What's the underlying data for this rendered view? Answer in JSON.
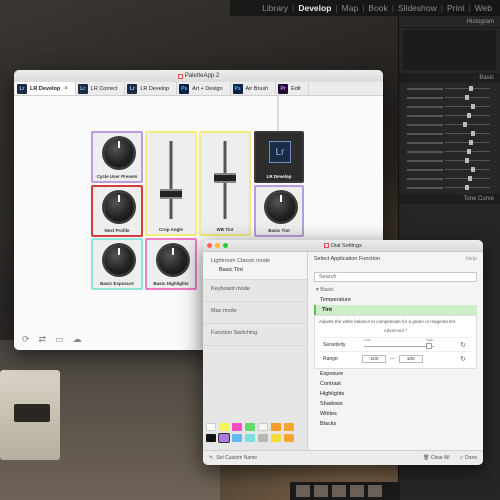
{
  "lightroom": {
    "modules": [
      "Library",
      "Develop",
      "Map",
      "Book",
      "Slideshow",
      "Print",
      "Web"
    ],
    "active_module": "Develop",
    "panel": {
      "histogram": "Histogram",
      "basic": "Basic",
      "tone_curve": "Tone Curve"
    }
  },
  "palette_window": {
    "title": "PaletteApp 2",
    "tabs": [
      {
        "icon": "Lr",
        "label": "LR Develop",
        "active": true
      },
      {
        "icon": "Lr",
        "label": "LR Correct"
      },
      {
        "icon": "Lr",
        "label": "LR Develop"
      },
      {
        "icon": "Ps",
        "label": "Art + Design"
      },
      {
        "icon": "Ps",
        "label": "Air Brush"
      },
      {
        "icon": "Pr",
        "label": "Edit"
      }
    ],
    "tiles": {
      "cycle_presets": "Cycle User Presets",
      "crop_angle": "Crop Angle",
      "wb_tint": "WB Tint",
      "lr_develop": "LR Develop",
      "next_profile": "Next Profile",
      "basic_tint": "Basic Tint",
      "basic_exposure": "Basic Exposure",
      "basic_highlights": "Basic Highlights"
    },
    "colors": {
      "purple": "#b89be0",
      "yellow": "#f3ec7a",
      "red": "#d93a3a",
      "teal": "#8fe3d6",
      "pink": "#f07ac7"
    }
  },
  "settings_window": {
    "title": "Dial Settings",
    "left": {
      "modes": [
        {
          "label": "Lightroom Classic mode",
          "sub": "Basic Tint"
        },
        {
          "label": "Keyboard mode"
        },
        {
          "label": "Mac mode"
        },
        {
          "label": "Function Switching"
        }
      ],
      "swatches": [
        "#ffffff",
        "#f5f55a",
        "#f24cc4",
        "#5fdc6a",
        "#f5f5f5",
        "#f49b2a",
        "#f5a72c",
        "#111111",
        "#a97ee0",
        "#62b8f0",
        "#7ae0e0",
        "#b6b6b6",
        "#f2dc3a",
        "#f5a72c"
      ]
    },
    "right": {
      "heading": "Select Application Function",
      "help": "Help",
      "search_value": "Search",
      "group": "Basic",
      "items": [
        "Temperature",
        "Tint",
        "Exposure",
        "Contrast",
        "Highlights",
        "Shadows",
        "Whites",
        "Blacks"
      ],
      "selected": "Tint",
      "description": "Adjusts the white balance to compensate for a green or magenta tint.",
      "advanced_label": "Advanced ^",
      "sensitivity_label": "Sensitivity",
      "sens_low": "Low",
      "sens_high": "High",
      "range_label": "Range",
      "range_min": "-100",
      "range_dash": "—",
      "range_max": "100"
    },
    "bottom": {
      "custom_name": "Set Custom Name",
      "clear_all": "Clear All",
      "done": "Done"
    }
  }
}
